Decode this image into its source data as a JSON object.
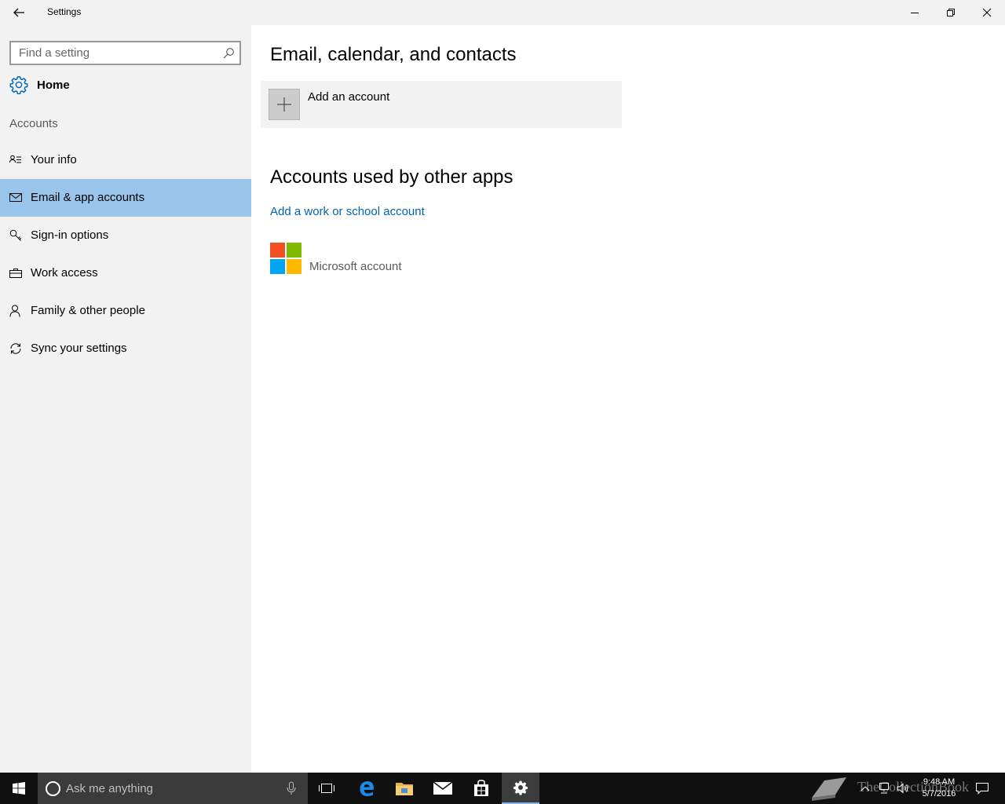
{
  "titlebar": {
    "title": "Settings",
    "back_icon": "back-arrow-icon",
    "minimize_icon": "minimize-icon",
    "restore_icon": "restore-icon",
    "close_icon": "close-icon"
  },
  "sidebar": {
    "search_placeholder": "Find a setting",
    "home_label": "Home",
    "section_label": "Accounts",
    "items": [
      {
        "label": "Your info",
        "icon": "contact-card-icon"
      },
      {
        "label": "Email & app accounts",
        "icon": "mail-icon",
        "selected": true
      },
      {
        "label": "Sign-in options",
        "icon": "key-icon"
      },
      {
        "label": "Work access",
        "icon": "briefcase-icon"
      },
      {
        "label": "Family & other people",
        "icon": "person-icon"
      },
      {
        "label": "Sync your settings",
        "icon": "sync-icon"
      }
    ],
    "selected_color": "#99c5ea"
  },
  "main": {
    "heading1": "Email, calendar, and contacts",
    "add_account_label": "Add an account",
    "heading2": "Accounts used by other apps",
    "work_school_link": "Add a work or school account",
    "ms_account_label": "Microsoft account",
    "link_color": "#0063b1"
  },
  "taskbar": {
    "search_placeholder": "Ask me anything",
    "time": "9:48 AM",
    "date": "5/7/2016",
    "watermark": "TheCollectionBook"
  }
}
